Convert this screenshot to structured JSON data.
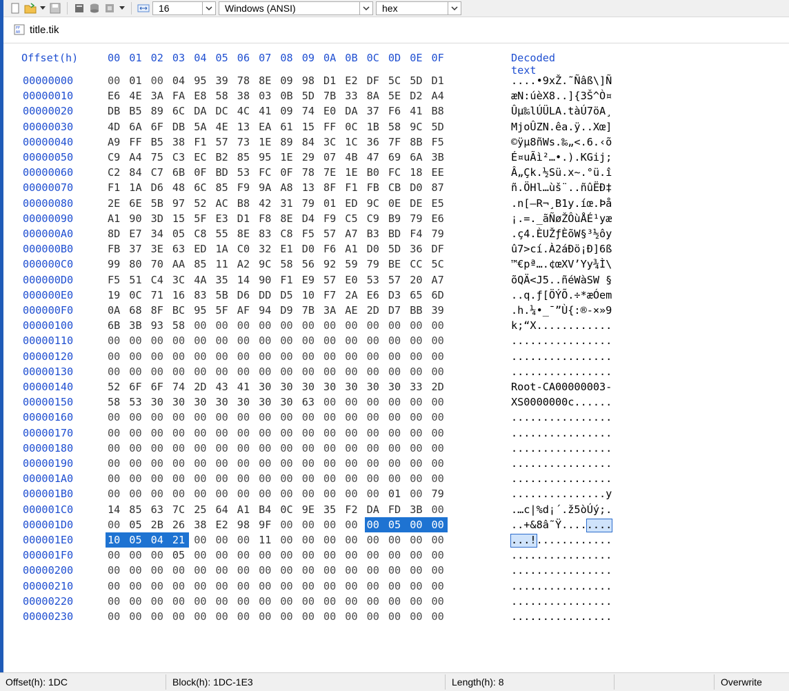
{
  "toolbar": {
    "bytes_per_row": "16",
    "encoding": "Windows (ANSI)",
    "display_mode": "hex",
    "icons": [
      "new-file-icon",
      "open-folder-icon",
      "save-icon",
      "properties-icon",
      "database-icon",
      "document-icon",
      "width-icon"
    ]
  },
  "tab": {
    "filename": "title.tik"
  },
  "header": {
    "offset": "Offset(h)",
    "columns": [
      "00",
      "01",
      "02",
      "03",
      "04",
      "05",
      "06",
      "07",
      "08",
      "09",
      "0A",
      "0B",
      "0C",
      "0D",
      "0E",
      "0F"
    ],
    "decoded": "Decoded text"
  },
  "rows": [
    {
      "offset": "00000000",
      "bytes": [
        "00",
        "01",
        "00",
        "04",
        "95",
        "39",
        "78",
        "8E",
        "09",
        "98",
        "D1",
        "E2",
        "DF",
        "5C",
        "5D",
        "D1"
      ],
      "decoded": "....•9xŽ.˜Ñâß\\]Ñ"
    },
    {
      "offset": "00000010",
      "bytes": [
        "E6",
        "4E",
        "3A",
        "FA",
        "E8",
        "58",
        "38",
        "03",
        "0B",
        "5D",
        "7B",
        "33",
        "8A",
        "5E",
        "D2",
        "A4"
      ],
      "decoded": "æN:úèX8..]{3Š^Ò¤"
    },
    {
      "offset": "00000020",
      "bytes": [
        "DB",
        "B5",
        "89",
        "6C",
        "DA",
        "DC",
        "4C",
        "41",
        "09",
        "74",
        "E0",
        "DA",
        "37",
        "F6",
        "41",
        "B8"
      ],
      "decoded": "Ûµ‰lÚÜLA.tàÚ7öA¸"
    },
    {
      "offset": "00000030",
      "bytes": [
        "4D",
        "6A",
        "6F",
        "DB",
        "5A",
        "4E",
        "13",
        "EA",
        "61",
        "15",
        "FF",
        "0C",
        "1B",
        "58",
        "9C",
        "5D"
      ],
      "decoded": "MjoÛZN.êa.ÿ..Xœ]"
    },
    {
      "offset": "00000040",
      "bytes": [
        "A9",
        "FF",
        "B5",
        "38",
        "F1",
        "57",
        "73",
        "1E",
        "89",
        "84",
        "3C",
        "1C",
        "36",
        "7F",
        "8B",
        "F5"
      ],
      "decoded": "©ÿµ8ñWs.‰„<.6.‹õ"
    },
    {
      "offset": "00000050",
      "bytes": [
        "C9",
        "A4",
        "75",
        "C3",
        "EC",
        "B2",
        "85",
        "95",
        "1E",
        "29",
        "07",
        "4B",
        "47",
        "69",
        "6A",
        "3B"
      ],
      "decoded": "É¤uÃì²…•.).KGij;"
    },
    {
      "offset": "00000060",
      "bytes": [
        "C2",
        "84",
        "C7",
        "6B",
        "0F",
        "BD",
        "53",
        "FC",
        "0F",
        "78",
        "7E",
        "1E",
        "B0",
        "FC",
        "18",
        "EE"
      ],
      "decoded": "Â„Çk.½Sü.x~.°ü.î"
    },
    {
      "offset": "00000070",
      "bytes": [
        "F1",
        "1A",
        "D6",
        "48",
        "6C",
        "85",
        "F9",
        "9A",
        "A8",
        "13",
        "8F",
        "F1",
        "FB",
        "CB",
        "D0",
        "87"
      ],
      "decoded": "ñ.ÖHl…ùš¨..ñûËÐ‡"
    },
    {
      "offset": "00000080",
      "bytes": [
        "2E",
        "6E",
        "5B",
        "97",
        "52",
        "AC",
        "B8",
        "42",
        "31",
        "79",
        "01",
        "ED",
        "9C",
        "0E",
        "DE",
        "E5"
      ],
      "decoded": ".n[—R¬¸B1y.íœ.Þå"
    },
    {
      "offset": "00000090",
      "bytes": [
        "A1",
        "90",
        "3D",
        "15",
        "5F",
        "E3",
        "D1",
        "F8",
        "8E",
        "D4",
        "F9",
        "C5",
        "C9",
        "B9",
        "79",
        "E6"
      ],
      "decoded": "¡.=._ãÑøŽÔùÅÉ¹yæ"
    },
    {
      "offset": "000000A0",
      "bytes": [
        "8D",
        "E7",
        "34",
        "05",
        "C8",
        "55",
        "8E",
        "83",
        "C8",
        "F5",
        "57",
        "A7",
        "B3",
        "BD",
        "F4",
        "79"
      ],
      "decoded": ".ç4.ÈUŽƒÈõW§³½ôy"
    },
    {
      "offset": "000000B0",
      "bytes": [
        "FB",
        "37",
        "3E",
        "63",
        "ED",
        "1A",
        "C0",
        "32",
        "E1",
        "D0",
        "F6",
        "A1",
        "D0",
        "5D",
        "36",
        "DF"
      ],
      "decoded": "û7>cí.À2áÐö¡Ð]6ß"
    },
    {
      "offset": "000000C0",
      "bytes": [
        "99",
        "80",
        "70",
        "AA",
        "85",
        "11",
        "A2",
        "9C",
        "58",
        "56",
        "92",
        "59",
        "79",
        "BE",
        "CC",
        "5C"
      ],
      "decoded": "™€pª….¢œXV’Yy¾Ì\\"
    },
    {
      "offset": "000000D0",
      "bytes": [
        "F5",
        "51",
        "C4",
        "3C",
        "4A",
        "35",
        "14",
        "90",
        "F1",
        "E9",
        "57",
        "E0",
        "53",
        "57",
        "20",
        "A7"
      ],
      "decoded": "õQÄ<J5..ñéWàSW §"
    },
    {
      "offset": "000000E0",
      "bytes": [
        "19",
        "0C",
        "71",
        "16",
        "83",
        "5B",
        "D6",
        "DD",
        "D5",
        "10",
        "F7",
        "2A",
        "E6",
        "D3",
        "65",
        "6D"
      ],
      "decoded": "..q.ƒ[ÖÝÕ.÷*æÓem"
    },
    {
      "offset": "000000F0",
      "bytes": [
        "0A",
        "68",
        "8F",
        "BC",
        "95",
        "5F",
        "AF",
        "94",
        "D9",
        "7B",
        "3A",
        "AE",
        "2D",
        "D7",
        "BB",
        "39"
      ],
      "decoded": ".h.¼•_¯”Ù{:®-×»9"
    },
    {
      "offset": "00000100",
      "bytes": [
        "6B",
        "3B",
        "93",
        "58",
        "00",
        "00",
        "00",
        "00",
        "00",
        "00",
        "00",
        "00",
        "00",
        "00",
        "00",
        "00"
      ],
      "decoded": "k;“X............"
    },
    {
      "offset": "00000110",
      "bytes": [
        "00",
        "00",
        "00",
        "00",
        "00",
        "00",
        "00",
        "00",
        "00",
        "00",
        "00",
        "00",
        "00",
        "00",
        "00",
        "00"
      ],
      "decoded": "................"
    },
    {
      "offset": "00000120",
      "bytes": [
        "00",
        "00",
        "00",
        "00",
        "00",
        "00",
        "00",
        "00",
        "00",
        "00",
        "00",
        "00",
        "00",
        "00",
        "00",
        "00"
      ],
      "decoded": "................"
    },
    {
      "offset": "00000130",
      "bytes": [
        "00",
        "00",
        "00",
        "00",
        "00",
        "00",
        "00",
        "00",
        "00",
        "00",
        "00",
        "00",
        "00",
        "00",
        "00",
        "00"
      ],
      "decoded": "................"
    },
    {
      "offset": "00000140",
      "bytes": [
        "52",
        "6F",
        "6F",
        "74",
        "2D",
        "43",
        "41",
        "30",
        "30",
        "30",
        "30",
        "30",
        "30",
        "30",
        "33",
        "2D"
      ],
      "decoded": "Root-CA00000003-"
    },
    {
      "offset": "00000150",
      "bytes": [
        "58",
        "53",
        "30",
        "30",
        "30",
        "30",
        "30",
        "30",
        "30",
        "63",
        "00",
        "00",
        "00",
        "00",
        "00",
        "00"
      ],
      "decoded": "XS0000000c......"
    },
    {
      "offset": "00000160",
      "bytes": [
        "00",
        "00",
        "00",
        "00",
        "00",
        "00",
        "00",
        "00",
        "00",
        "00",
        "00",
        "00",
        "00",
        "00",
        "00",
        "00"
      ],
      "decoded": "................"
    },
    {
      "offset": "00000170",
      "bytes": [
        "00",
        "00",
        "00",
        "00",
        "00",
        "00",
        "00",
        "00",
        "00",
        "00",
        "00",
        "00",
        "00",
        "00",
        "00",
        "00"
      ],
      "decoded": "................"
    },
    {
      "offset": "00000180",
      "bytes": [
        "00",
        "00",
        "00",
        "00",
        "00",
        "00",
        "00",
        "00",
        "00",
        "00",
        "00",
        "00",
        "00",
        "00",
        "00",
        "00"
      ],
      "decoded": "................"
    },
    {
      "offset": "00000190",
      "bytes": [
        "00",
        "00",
        "00",
        "00",
        "00",
        "00",
        "00",
        "00",
        "00",
        "00",
        "00",
        "00",
        "00",
        "00",
        "00",
        "00"
      ],
      "decoded": "................"
    },
    {
      "offset": "000001A0",
      "bytes": [
        "00",
        "00",
        "00",
        "00",
        "00",
        "00",
        "00",
        "00",
        "00",
        "00",
        "00",
        "00",
        "00",
        "00",
        "00",
        "00"
      ],
      "decoded": "................"
    },
    {
      "offset": "000001B0",
      "bytes": [
        "00",
        "00",
        "00",
        "00",
        "00",
        "00",
        "00",
        "00",
        "00",
        "00",
        "00",
        "00",
        "00",
        "01",
        "00",
        "79"
      ],
      "decoded": "...............y"
    },
    {
      "offset": "000001C0",
      "bytes": [
        "14",
        "85",
        "63",
        "7C",
        "25",
        "64",
        "A1",
        "B4",
        "0C",
        "9E",
        "35",
        "F2",
        "DA",
        "FD",
        "3B",
        "00"
      ],
      "decoded": ".…c|%d¡´.ž5òÚý;."
    },
    {
      "offset": "000001D0",
      "bytes": [
        "00",
        "05",
        "2B",
        "26",
        "38",
        "E2",
        "98",
        "9F",
        "00",
        "00",
        "00",
        "00",
        "00",
        "05",
        "00",
        "00"
      ],
      "decoded": "..+&8â˜Ÿ........"
    },
    {
      "offset": "000001E0",
      "bytes": [
        "10",
        "05",
        "04",
        "21",
        "00",
        "00",
        "00",
        "11",
        "00",
        "00",
        "00",
        "00",
        "00",
        "00",
        "00",
        "00"
      ],
      "decoded": "...!............"
    },
    {
      "offset": "000001F0",
      "bytes": [
        "00",
        "00",
        "00",
        "05",
        "00",
        "00",
        "00",
        "00",
        "00",
        "00",
        "00",
        "00",
        "00",
        "00",
        "00",
        "00"
      ],
      "decoded": "................"
    },
    {
      "offset": "00000200",
      "bytes": [
        "00",
        "00",
        "00",
        "00",
        "00",
        "00",
        "00",
        "00",
        "00",
        "00",
        "00",
        "00",
        "00",
        "00",
        "00",
        "00"
      ],
      "decoded": "................"
    },
    {
      "offset": "00000210",
      "bytes": [
        "00",
        "00",
        "00",
        "00",
        "00",
        "00",
        "00",
        "00",
        "00",
        "00",
        "00",
        "00",
        "00",
        "00",
        "00",
        "00"
      ],
      "decoded": "................"
    },
    {
      "offset": "00000220",
      "bytes": [
        "00",
        "00",
        "00",
        "00",
        "00",
        "00",
        "00",
        "00",
        "00",
        "00",
        "00",
        "00",
        "00",
        "00",
        "00",
        "00"
      ],
      "decoded": "................"
    },
    {
      "offset": "00000230",
      "bytes": [
        "00",
        "00",
        "00",
        "00",
        "00",
        "00",
        "00",
        "00",
        "00",
        "00",
        "00",
        "00",
        "00",
        "00",
        "00",
        "00"
      ],
      "decoded": "................"
    }
  ],
  "selection": {
    "start": "1DC",
    "end": "1E3",
    "length": "8"
  },
  "status": {
    "offset": "Offset(h): 1DC",
    "block": "Block(h): 1DC-1E3",
    "length": "Length(h): 8",
    "mode": "Overwrite"
  },
  "colors": {
    "offset_blue": "#1f4fd1",
    "selection_blue": "#1e73d2",
    "decoded_selection_fill": "#cfe3fb"
  }
}
